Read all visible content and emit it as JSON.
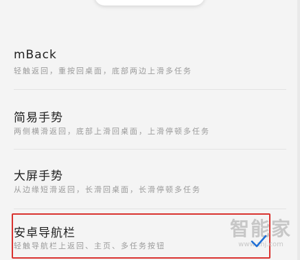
{
  "options": [
    {
      "title": "mBack",
      "description": "轻触返回，重按回桌面，底部两边上滑多任务"
    },
    {
      "title": "简易手势",
      "description": "两侧横滑返回，底部上滑回桌面，上滑停顿多任务"
    },
    {
      "title": "大屏手势",
      "description": "从边缘短滑返回，长滑回桌面，长滑停顿多任务"
    },
    {
      "title": "安卓导航栏",
      "description": "轻触导航栏上返回、主页、多任务按钮",
      "selected": true
    }
  ],
  "watermark": {
    "text": "智能家",
    "url": "www.znj.com"
  },
  "colors": {
    "highlight_border": "#d9312e",
    "check": "#1f6fd6"
  },
  "icons": {
    "selected": "check-icon"
  }
}
